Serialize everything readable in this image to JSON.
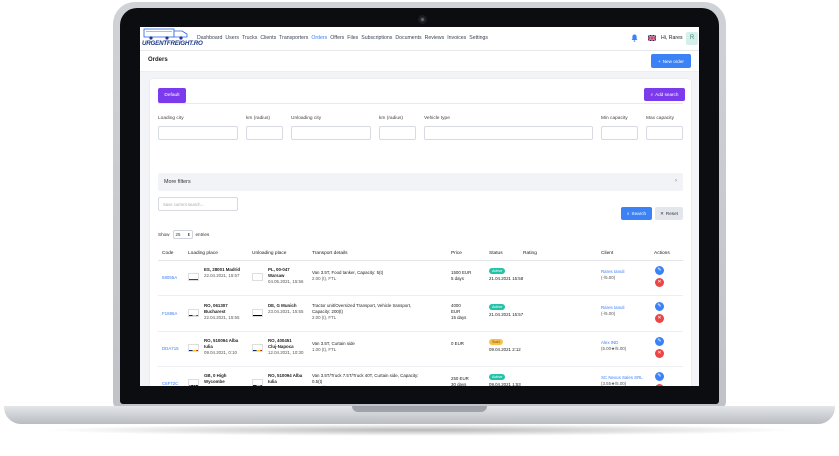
{
  "colors": {
    "primary": "#3b82f6",
    "purple": "#7c3aed",
    "danger": "#ef4444",
    "active": "#22c3a6",
    "sold": "#f6c14b"
  },
  "logo": {
    "text": "URGENTFREIGHT.RO"
  },
  "nav": [
    "Dashboard",
    "Users",
    "Trucks",
    "Clients",
    "Transporters",
    "Orders",
    "Offers",
    "Files",
    "Subscriptions",
    "Documents",
    "Reviews",
    "Invoices",
    "Settings"
  ],
  "nav_active": "Orders",
  "user": {
    "greeting": "Hi, Rares",
    "avatar": "R"
  },
  "page": {
    "title": "Orders",
    "new_order": "New order"
  },
  "filters": {
    "tab_default": "Default",
    "add_search": "Add search",
    "loading_city": "Loading city",
    "km_radius_1": "km (radius)",
    "unloading_city": "Unloading city",
    "km_radius_2": "km (radius)",
    "vehicle_type": "Vehicle type",
    "min_capacity": "Min capacity",
    "max_capacity": "Max capacity",
    "more_filters": "More filters",
    "save_placeholder": "Save current search...",
    "search": "Search",
    "reset": "Reset"
  },
  "table": {
    "show": "Show",
    "page_size": "25",
    "entries": "entries",
    "headers": {
      "code": "Code",
      "loading": "Loading place",
      "unloading": "Unloading place",
      "transport": "Transport details",
      "price": "Price",
      "status": "Status",
      "rating": "Rating",
      "client": "Client",
      "actions": "Actions"
    },
    "rows": [
      {
        "code": "58055A",
        "load_flag": "es",
        "load_place": "ES, 28001 Madrid",
        "load_date": "22.04.2021, 15:57",
        "unload_flag": "pl",
        "unload_place": "PL, 00-047",
        "unload_place2": "Warsaw",
        "unload_date": "04.05.2021, 15:56",
        "transport1": "Van 3.5T, Food tanker, Capacity: 5(t)",
        "transport2": "",
        "transport3": "2.00 (t), FTL",
        "transport4": "",
        "price": "1500 EUR",
        "price2": "5 days",
        "status": "Active",
        "status_type": "active",
        "status_date": "21.04.2021 15:58",
        "client": "Rares Ianuli",
        "client_rating": "(-/5.00)"
      },
      {
        "code": "F1886A",
        "load_flag": "ro",
        "load_place": "RO, 061307",
        "load_place2": "Bucharest",
        "load_date": "22.04.2021, 15:55",
        "unload_flag": "de",
        "unload_place": "DE, G Munich",
        "unload_place2": "",
        "unload_date": "23.04.2021, 15:55",
        "transport1": "Tractor unit/Oversized Transport, Vehicle transport,",
        "transport2": "Capacity: 200(t)",
        "transport3": "2.00 (t), FTL",
        "transport4": "",
        "price": "4000",
        "price2": "EUR",
        "price3": "15 days",
        "status": "Active",
        "status_type": "active",
        "status_date": "21.04.2021 15:57",
        "client": "Rares Ianuli",
        "client_rating": "(-/5.00)"
      },
      {
        "code": "DDA715",
        "load_flag": "ro",
        "load_place": "RO, 510094 Alba",
        "load_place2": "Iulia",
        "load_date": "09.04.2021, 0:10",
        "unload_flag": "ro",
        "unload_place": "RO, 400451",
        "unload_place2": "Cluj-Napoca",
        "unload_date": "12.04.2021, 10:30",
        "transport1": "Van 3.5T, Curtain side",
        "transport2": "",
        "transport3": "1.00 (t), FTL",
        "transport4": "",
        "price": "0 EUR",
        "price2": "",
        "status": "Sold",
        "status_type": "sold",
        "status_date": "09.04.2021 2:12",
        "client": "Alex IND",
        "client_rating": "(5.00★/5.00)"
      },
      {
        "code": "C6F72C",
        "load_flag": "gb",
        "load_place": "GB, 0 High",
        "load_place2": "Wycombe",
        "load_date": "09.04.2021, 23:50",
        "unload_flag": "ro",
        "unload_place": "RO, 510094 Alba",
        "unload_place2": "Iulia",
        "unload_date": "16.04.2021, 23:50",
        "transport1": "Van 3.5T/Truck 7.5T/Truck 40T, Curtain side, Capacity:",
        "transport2": "0.5(t)",
        "transport3": "0.50 (t), LTL",
        "transport4": "1 x 1.2(m) x 0.8(m) x 1(m)",
        "price": "250 EUR",
        "price2": "30 days",
        "status": "Active",
        "status_type": "active",
        "status_date": "09.04.2021 1:53",
        "client": "SC Nexus Sales SRL",
        "client_rating": "(3.55★/5.00)"
      }
    ]
  }
}
